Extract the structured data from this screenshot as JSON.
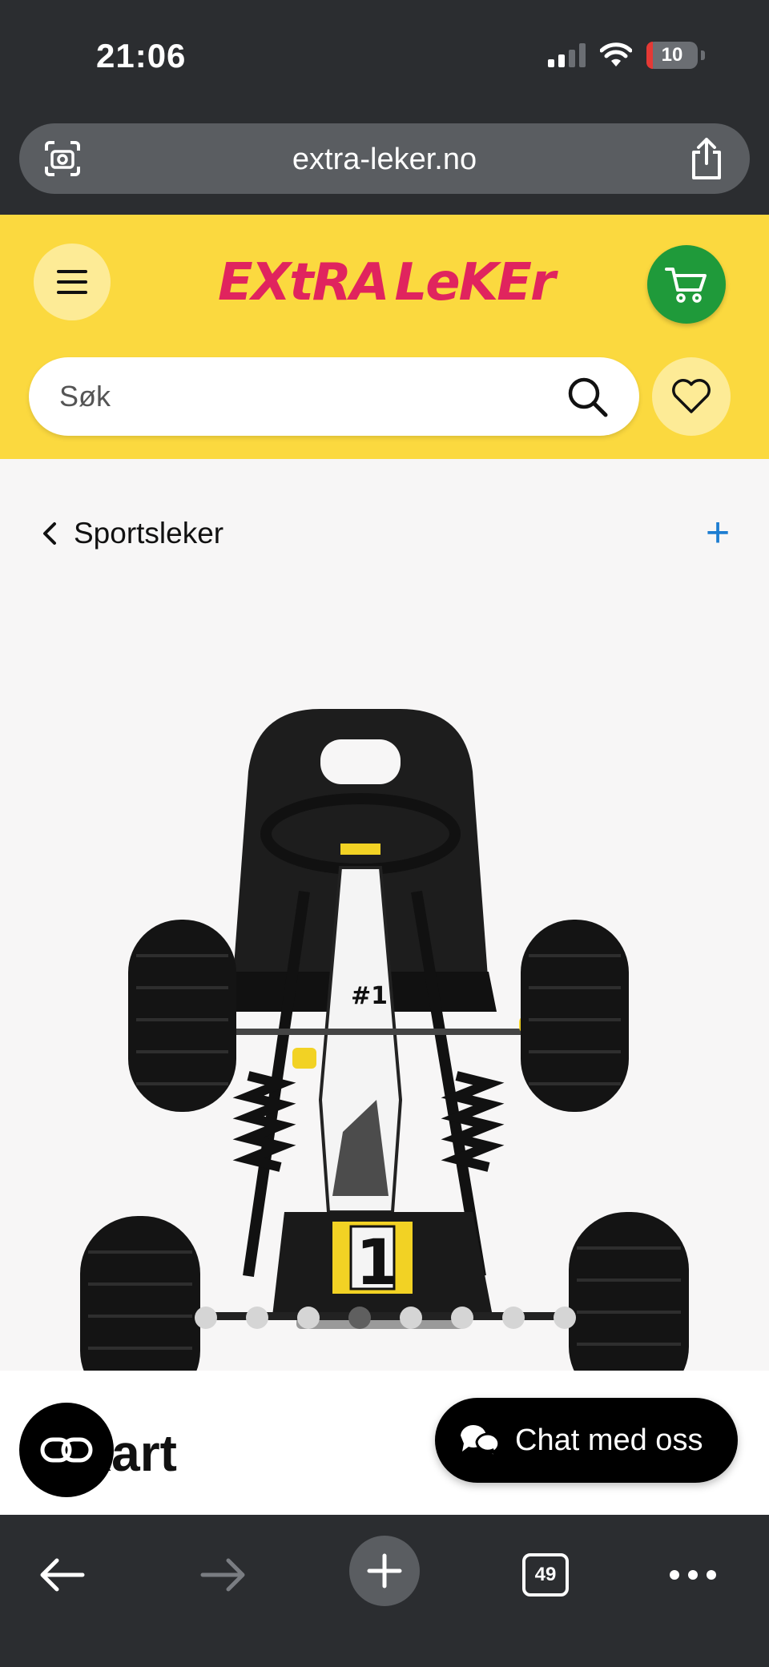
{
  "status_bar": {
    "time": "21:06",
    "battery": "10"
  },
  "browser": {
    "url": "extra-leker.no",
    "tabs_count": "49"
  },
  "header": {
    "logo_left": "EXtRA",
    "logo_right": "LeKEr",
    "search_placeholder": "Søk"
  },
  "breadcrumb": {
    "label": "Sportsleker"
  },
  "product": {
    "title_visible": "o Kart",
    "image_dots": 8,
    "active_dot": 4,
    "badge_number": "1"
  },
  "chat": {
    "label": "Chat med oss"
  },
  "colors": {
    "header_yellow": "#fbd93f",
    "cart_green": "#1f9a3a",
    "link_blue": "#1d7dd1",
    "browser_chrome": "#2b2d30"
  },
  "icons": {
    "url_left": "camera-scan-icon",
    "url_right": "share-icon",
    "menu": "hamburger-icon",
    "cart": "cart-icon",
    "search": "search-icon",
    "wishlist": "heart-icon",
    "back": "chevron-left-icon",
    "expand": "plus-icon",
    "ai": "link-icon",
    "chat": "chat-bubble-icon"
  }
}
